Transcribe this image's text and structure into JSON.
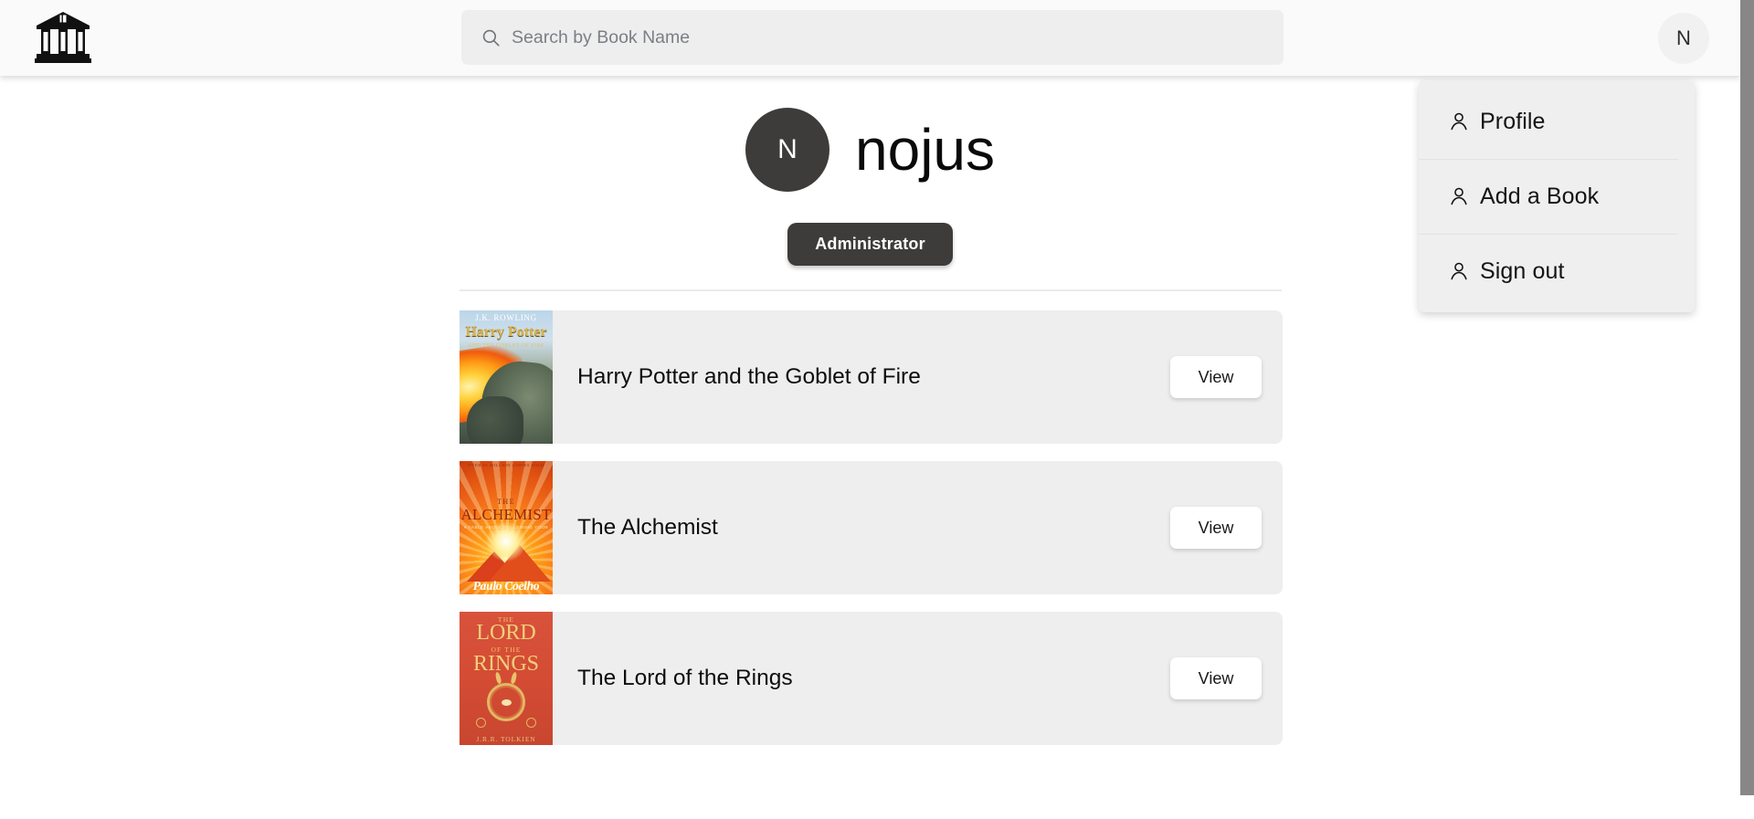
{
  "header": {
    "logo_icon": "library-building-icon",
    "search": {
      "icon": "search-icon",
      "placeholder": "Search by Book Name",
      "value": ""
    },
    "avatar_initial": "N"
  },
  "dropdown": {
    "items": [
      {
        "icon": "person-icon",
        "label": "Profile"
      },
      {
        "icon": "person-icon",
        "label": "Add a Book"
      },
      {
        "icon": "person-icon",
        "label": "Sign out"
      }
    ]
  },
  "profile": {
    "avatar_initial": "N",
    "name": "nojus",
    "role_badge": "Administrator"
  },
  "books": [
    {
      "title": "Harry Potter and the Goblet of Fire",
      "view_label": "View",
      "cover": {
        "style": "harry-potter",
        "author_line": "J.K. ROWLING",
        "title_line": "Harry Potter",
        "sub_line": "AND THE GOBLET OF FIRE"
      }
    },
    {
      "title": "The Alchemist",
      "view_label": "View",
      "cover": {
        "style": "alchemist",
        "top_line": "OVER 65 MILLION COPIES SOLD",
        "the_line": "THE",
        "title_line": "ALCHEMIST",
        "tag_line": "A FABLE ABOUT FOLLOWING YOUR DREAM",
        "author_line": "Paulo Coelho"
      }
    },
    {
      "title": "The Lord of the Rings",
      "view_label": "View",
      "cover": {
        "style": "lord-of-the-rings",
        "the_line": "THE",
        "lord_line": "LORD",
        "ofthe_line": "OF THE",
        "rings_line": "RINGS",
        "author_line": "J.R.R. TOLKIEN"
      }
    }
  ],
  "colors": {
    "header_bg": "#fafafa",
    "search_bg": "#eeeeee",
    "row_bg": "#eeeeee",
    "dark": "#3d3c3b",
    "menu_bg": "#efefef",
    "scrollbar": "#878787"
  }
}
